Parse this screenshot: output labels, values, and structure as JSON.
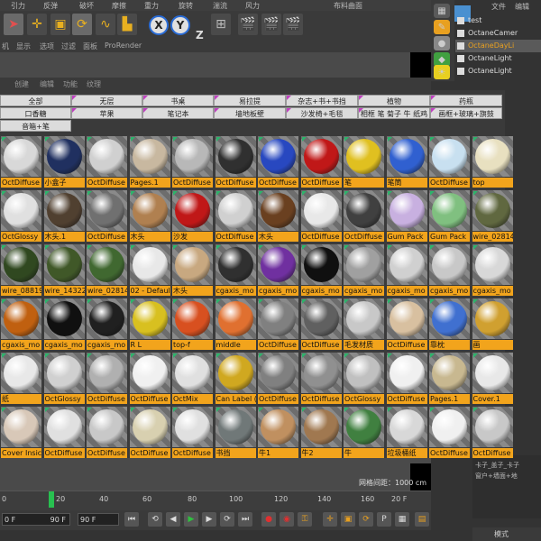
{
  "top_menu": [
    "引力",
    "反弹",
    "破坏",
    "摩擦",
    "重力",
    "旋转",
    "湍流",
    "风力",
    "布料曲面"
  ],
  "toolbar": {
    "icons": [
      "cursor-icon",
      "move-icon",
      "scale-icon",
      "rotate-icon",
      "spline-icon",
      "coord-icon",
      "x-axis-icon",
      "y-axis-icon",
      "z-axis-icon",
      "render-view-icon",
      "render-icon",
      "render-settings-icon"
    ],
    "axis_x": "X",
    "axis_y": "Y",
    "axis_z": "Z"
  },
  "editor_menu": [
    "机",
    "显示",
    "选项",
    "过滤",
    "面板",
    "ProRender"
  ],
  "mm_menu": [
    "创建",
    "编辑",
    "功能",
    "纹理"
  ],
  "object_panel": {
    "menu": [
      "文件",
      "编辑"
    ],
    "objects": [
      "test",
      "OctaneCamer",
      "OctaneDayLi",
      "OctaneLight",
      "OctaneLight"
    ]
  },
  "categories": [
    "全部",
    "无层",
    "书桌",
    "易拉提",
    "杂志+书+书挡",
    "植物",
    "药瓶",
    "口香糖",
    "苹果",
    "笔记本",
    "墙地板壁",
    "沙发椅+毛毯",
    "相框 笔 菊子 牛 纸鸡",
    "画框+玻璃+旗鼓",
    "音箱+笔"
  ],
  "materials": [
    [
      "OctDiffuse",
      "小盒子",
      "OctDiffuse",
      "Pages.1",
      "OctDiffuse",
      "OctDiffuse",
      "OctDiffuse",
      "OctDiffuse",
      "笔",
      "笔筒",
      "OctDiffuse",
      "top"
    ],
    [
      "OctGlossy",
      "木头.1",
      "OctDiffuse",
      "木头",
      "沙发",
      "OctDiffuse",
      "木头",
      "OctDiffuse",
      "OctDiffuse",
      "Gum Pack",
      "Gum Pack",
      "wire_02814"
    ],
    [
      "wire_08819",
      "wire_14322",
      "wire_02814",
      "02 - Default",
      "木头",
      "cgaxis_mo",
      "cgaxis_mo",
      "cgaxis_mo",
      "cgaxis_mo",
      "cgaxis_mo",
      "cgaxis_mo",
      "cgaxis_mo"
    ],
    [
      "cgaxis_mo",
      "cgaxis_mo",
      "cgaxis_mo",
      "R L",
      "top-f",
      "middle",
      "OctDiffuse",
      "OctDiffuse",
      "毛发材质",
      "OctDiffuse",
      "靠枕",
      "画"
    ],
    [
      "纸",
      "OctGlossy",
      "OctDiffuse",
      "OctDiffuse",
      "OctMix",
      "Can Label (",
      "OctDiffuse",
      "OctDiffuse",
      "OctGlossy",
      "OctDiffuse",
      "Pages.1",
      "Cover.1"
    ],
    [
      "Cover Insic",
      "OctDiffuse",
      "OctDiffuse",
      "OctDiffuse",
      "OctDiffuse",
      "书挡",
      "牛1",
      "牛2",
      "牛",
      "垃圾桶纸",
      "OctDiffuse",
      "OctDiffuse"
    ]
  ],
  "sphere_colors": [
    [
      "#d8d8d8",
      "#203060",
      "#d0d0d0",
      "#c8b8a0",
      "#b8b8b8",
      "#303030",
      "#2848c0",
      "#c01818",
      "#e0c020",
      "#3060d0",
      "#c8e0f0",
      "#e8e0c0"
    ],
    [
      "#e0e0e0",
      "#504030",
      "#707070",
      "#b08050",
      "#c01818",
      "#d0d0d0",
      "#6a4020",
      "#e8e8e8",
      "#404040",
      "#c8b0e0",
      "#80c080",
      "#606840"
    ],
    [
      "#304820",
      "#405828",
      "#406830",
      "#e8e8e8",
      "#c8a880",
      "#303030",
      "#7030a0",
      "#101010",
      "#a0a0a0",
      "#d0d0d0",
      "#c8c8c8",
      "#d8d8d8"
    ],
    [
      "#c06010",
      "#101010",
      "#202020",
      "#d8c020",
      "#d85020",
      "#e07030",
      "#808080",
      "#606060",
      "#c8c8c8",
      "#d8c0a0",
      "#4070d0",
      "#d0a030"
    ],
    [
      "#e8e8e8",
      "#d0d0d0",
      "#b0b0b0",
      "#f0f0f0",
      "#e0e0e0",
      "#d0a820",
      "#808080",
      "#909090",
      "#c0c0c0",
      "#f0f0f0",
      "#c8b890",
      "#e8e8e8"
    ],
    [
      "#d8c8b8",
      "#e0e0e0",
      "#c8c8c8",
      "#d8d0b0",
      "#e0e0e0",
      "#707878",
      "#c09060",
      "#a07850",
      "#408040",
      "#d8d8d8",
      "#f0f0f0",
      "#c8c8c8"
    ]
  ],
  "selected_material_label_color": "#f2a41c",
  "distance_label": "网格间距：1000 cm",
  "timeline": {
    "ticks": [
      "0",
      "20",
      "40",
      "60",
      "80",
      "100",
      "120",
      "140",
      "160"
    ],
    "current_frame": "20",
    "end": "20 F"
  },
  "play_controls": {
    "start_field": "0 F",
    "min_field": "90 F",
    "max_field": "90 F"
  },
  "layer_panel": [
    "卡子_盖子_卡子",
    "窗户+墙面+地"
  ],
  "mode_bar": "模式"
}
